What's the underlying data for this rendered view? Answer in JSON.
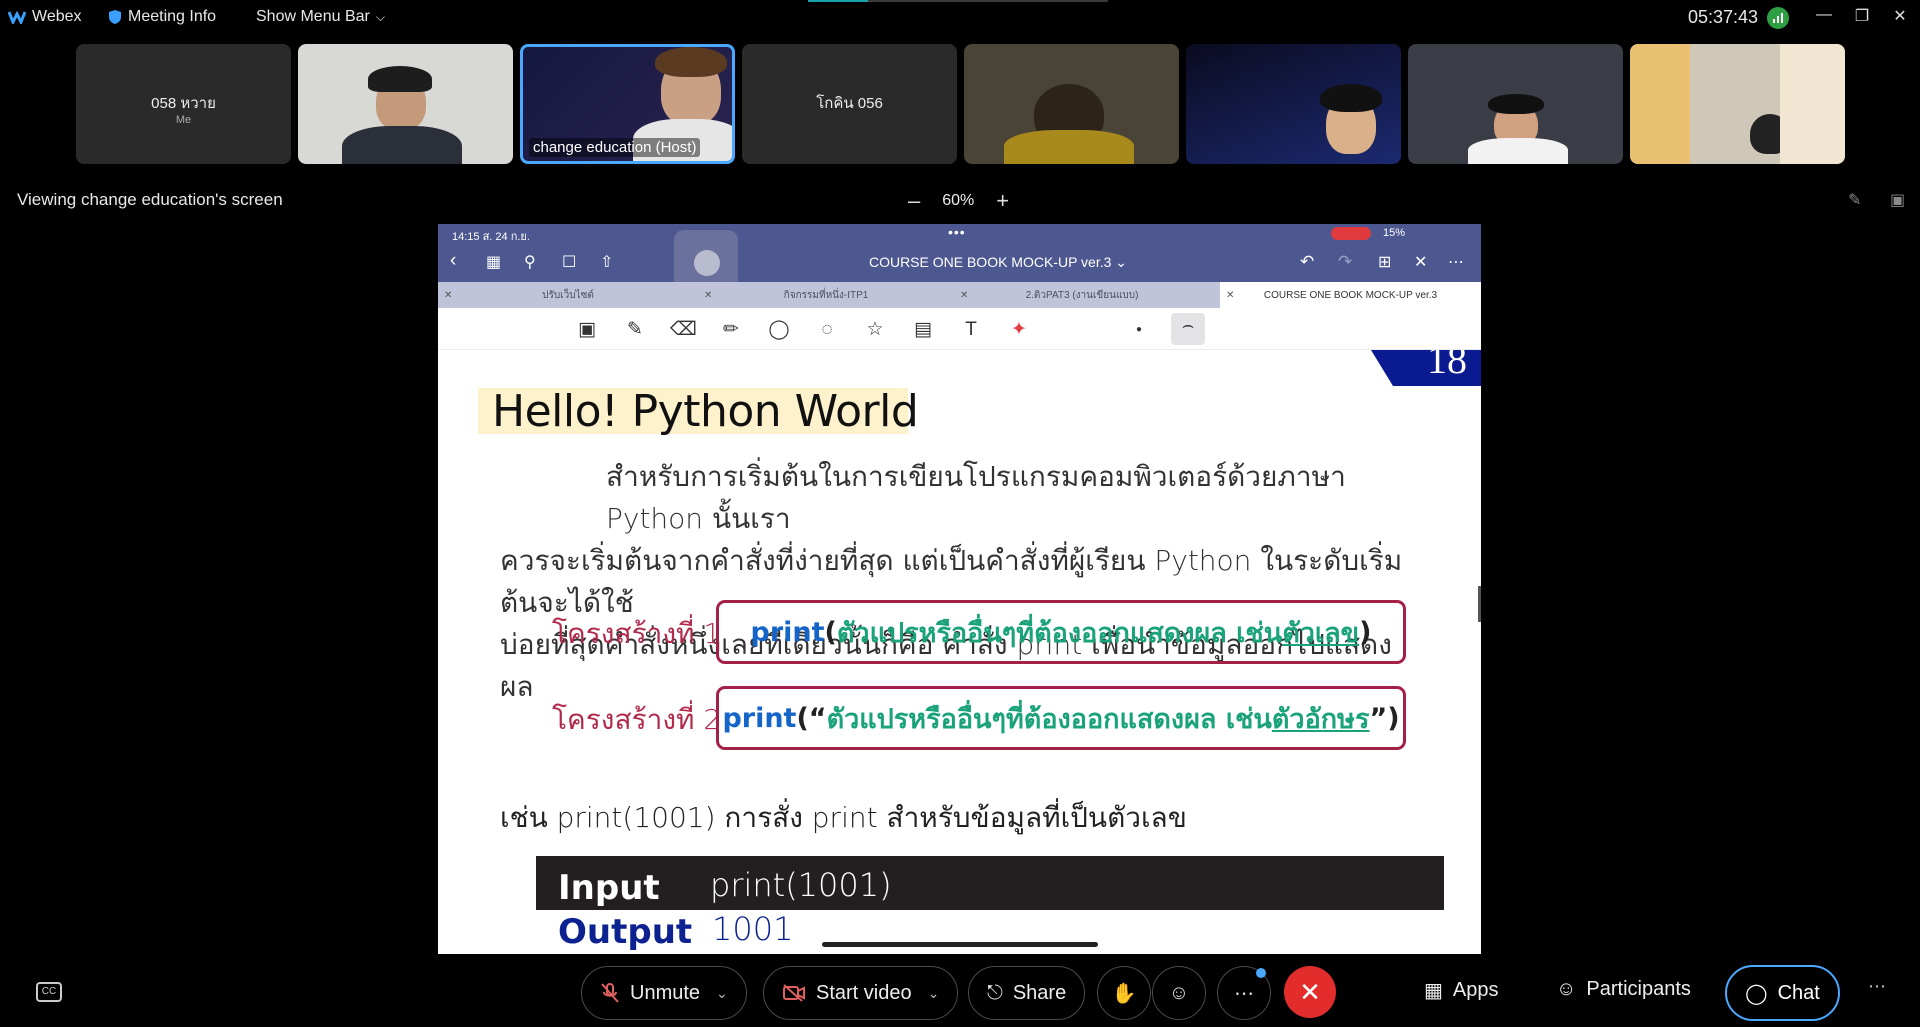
{
  "topbar": {
    "app_name": "Webex",
    "meeting_info": "Meeting Info",
    "show_menu_bar": "Show Menu Bar",
    "time": "05:37:43"
  },
  "participants": [
    {
      "name": "058 หวาย",
      "sub": "Me"
    },
    {
      "name": ""
    },
    {
      "name": "change education (Host)"
    },
    {
      "name": "โกคิน 056"
    },
    {
      "name": ""
    },
    {
      "name": ""
    },
    {
      "name": ""
    },
    {
      "name": ""
    }
  ],
  "viewing": {
    "label": "Viewing change education's screen",
    "zoom": "60%"
  },
  "ipad": {
    "status_left": "14:15  ส. 24 ก.ย.",
    "status_dots": "•••",
    "battery": "15%",
    "doc_title": "COURSE ONE BOOK MOCK-UP ver.3",
    "tabs": [
      "ปรับเว็บไซต์",
      "กิจกรรมที่หนึ่ง-ITP1",
      "2.ติวPAT3 (งานเขียนแบบ)",
      "COURSE ONE BOOK MOCK-UP ver.3"
    ]
  },
  "doc": {
    "page_corner": "18",
    "heading": "Hello! Python World",
    "para_line1": "สำหรับการเริ่มต้นในการเขียนโปรแกรมคอมพิวเตอร์ด้วยภาษา Python นั้นเรา",
    "para_line2": "ควรจะเริ่มต้นจากคำสั่งที่ง่ายที่สุด แต่เป็นคำสั่งที่ผู้เรียน Python ในระดับเริ่มต้นจะได้ใช้",
    "para_line3": "บ่อยที่สุดคำสั่งหนึ่งเลยทีเดียวนั้นก็คือ คำสั่ง print เพื่อนำข้อมูลออกไปแสดงผล",
    "struct1": {
      "label": "โครงสร้างที่ 1",
      "kw": "print",
      "open": "(",
      "text": "ตัวแปรหรืออื่นๆที่ต้องออกแสดงผล เช่น ",
      "example": "ตัวเลข",
      "close": ")"
    },
    "struct2": {
      "label": "โครงสร้างที่ 2",
      "kw": "print",
      "open": "(“",
      "text": "ตัวแปรหรืออื่นๆที่ต้องออกแสดงผล เช่น ",
      "example": "ตัวอักษร",
      "close_q": "”",
      "close": ")"
    },
    "example_line": "เช่น print(1001) การสั่ง print สำหรับข้อมูลที่เป็นตัวเลข",
    "input_label": "Input",
    "input_value": "print(1001)",
    "output_label": "Output",
    "output_value": "1001"
  },
  "bottom": {
    "unmute": "Unmute",
    "start_video": "Start video",
    "share": "Share",
    "apps": "Apps",
    "participants": "Participants",
    "chat": "Chat"
  }
}
